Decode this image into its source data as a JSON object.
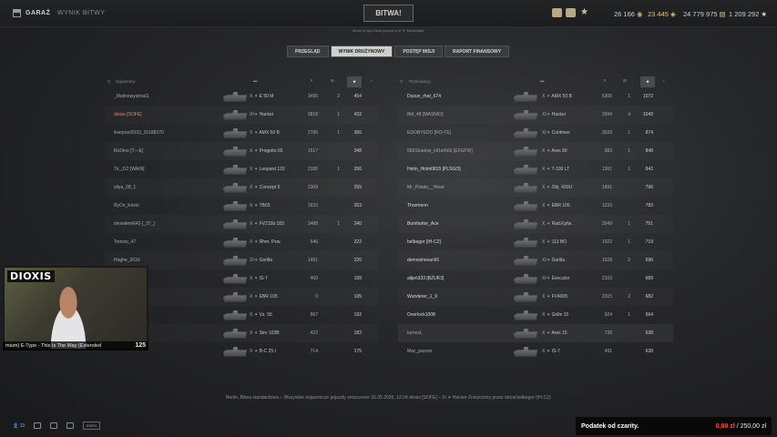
{
  "topbar": {
    "garage": "GARAŻ",
    "battle_results": "WYNIK BITWY",
    "battle_button": "BITWA!",
    "subline": "Może to być Ginie pozom a XI ✦ Wrushkiller",
    "credits": "26 166",
    "gold": "23 445",
    "free_xp": "24 779 975",
    "bonds": "1 209 292"
  },
  "tabs": [
    "PRZEGLĄD",
    "WYNIK DRUŻYNOWY",
    "POSTĘP MISJI",
    "RAPORT FINANSOWY"
  ],
  "active_tab": 1,
  "left_team": {
    "title": "Sojusznicy",
    "players": [
      {
        "name": "_Malinowystrzal1",
        "tier": "X",
        "tank": "E 50 M",
        "dmg": "3495",
        "kills": "2",
        "xp": "454"
      },
      {
        "name": "dioxis [SOFE]",
        "tier": "XI",
        "tank": "Hacker",
        "dmg": "3818",
        "kills": "1",
        "xp": "432",
        "own": true
      },
      {
        "name": "liverpool2033_15188370",
        "tier": "X",
        "tank": "AMX 50 B",
        "dmg": "2786",
        "kills": "1",
        "xp": "366"
      },
      {
        "name": "RoDino [T—E]",
        "tier": "X",
        "tank": "Progetto 65",
        "dmg": "1517",
        "kills": "",
        "xp": "348"
      },
      {
        "name": "Tir_J12 [WAIN]",
        "tier": "X",
        "tank": "Leopard 120",
        "dmg": "2186",
        "kills": "1",
        "xp": "266"
      },
      {
        "name": "vitya_98_1",
        "tier": "X",
        "tank": "Concept 5",
        "dmg": "2309",
        "kills": "",
        "xp": "255"
      },
      {
        "name": "RyOs_Kevin",
        "tier": "X",
        "tank": "TB03",
        "dmg": "1633",
        "kills": "",
        "xp": "253"
      },
      {
        "name": "showtime643 [_37_]",
        "tier": "X",
        "tank": "FV215b 183",
        "dmg": "1488",
        "kills": "1",
        "xp": "240"
      },
      {
        "name": "Tomcio_47",
        "tier": "X",
        "tank": "Rhm. Pzw.",
        "dmg": "646",
        "kills": "",
        "xp": "222"
      },
      {
        "name": "Hoghe_2016",
        "tier": "XI",
        "tank": "Gorilla",
        "dmg": "1491",
        "kills": "",
        "xp": "220"
      },
      {
        "name": "",
        "tier": "X",
        "tank": "IS-7",
        "dmg": "469",
        "kills": "",
        "xp": "199"
      },
      {
        "name": "",
        "tier": "X",
        "tank": "EBR 105",
        "dmg": "0",
        "kills": "",
        "xp": "195"
      },
      {
        "name": "",
        "tier": "X",
        "tank": "Vz. 55",
        "dmg": "867",
        "kills": "",
        "xp": "192"
      },
      {
        "name": "",
        "tier": "X",
        "tank": "Strv 103B",
        "dmg": "422",
        "kills": "",
        "xp": "182"
      },
      {
        "name": "",
        "tier": "X",
        "tank": "B-C 25 t",
        "dmg": "714",
        "kills": "",
        "xp": "175"
      }
    ]
  },
  "right_team": {
    "title": "Przeciwnicy",
    "players": [
      {
        "name": "Dusun_rhat_674",
        "tier": "X",
        "tank": "AMX 50 B",
        "dmg": "6306",
        "kills": "1",
        "xp": "1072",
        "alive": true
      },
      {
        "name": "Bitt_48 [MASNIO]",
        "tier": "XI",
        "tank": "Hacker",
        "dmg": "2594",
        "kills": "4",
        "xp": "1049"
      },
      {
        "name": "EDOBYEDO [RO-TE]",
        "tier": "XI",
        "tank": "Contriver",
        "dmg": "3529",
        "kills": "1",
        "xp": "874"
      },
      {
        "name": "666Shadow_kil1er666 [EFGFW]",
        "tier": "X",
        "tank": "Ares 90",
        "dmg": "983",
        "kills": "1",
        "xp": "848"
      },
      {
        "name": "Helm_Holm0815 [PLSGO]",
        "tier": "X",
        "tank": "T-100 LT",
        "dmg": "1361",
        "kills": "1",
        "xp": "842",
        "alive": true
      },
      {
        "name": "Mr_Potato__Head",
        "tier": "X",
        "tank": "Obj. 430U",
        "dmg": "1891",
        "kills": "",
        "xp": "796"
      },
      {
        "name": "Thormenn",
        "tier": "X",
        "tank": "EBR 105",
        "dmg": "1233",
        "kills": "",
        "xp": "783",
        "alive": true
      },
      {
        "name": "Bomfanter_Ace",
        "tier": "X",
        "tank": "Rad.Kpfw.",
        "dmg": "2649",
        "kills": "1",
        "xp": "751",
        "alive": true
      },
      {
        "name": "belbegor [IH-CZ]",
        "tier": "X",
        "tank": "113 BO",
        "dmg": "1022",
        "kills": "1",
        "xp": "719",
        "alive": true
      },
      {
        "name": "demnishevan91",
        "tier": "XI",
        "tank": "Gorilla",
        "dmg": "1528",
        "kills": "2",
        "xp": "696",
        "alive": true
      },
      {
        "name": "alijen333 [BZUK3]",
        "tier": "XI",
        "tank": "Executor",
        "dmg": "2103",
        "kills": "",
        "xp": "689",
        "alive": true
      },
      {
        "name": "Wunderer_1_9",
        "tier": "X",
        "tank": "FV4005",
        "dmg": "2315",
        "kills": "2",
        "xp": "682",
        "alive": true
      },
      {
        "name": "Overlock1008",
        "tier": "X",
        "tank": "Grille 15",
        "dmg": "924",
        "kills": "1",
        "xp": "664",
        "alive": true
      },
      {
        "name": "turnoxL",
        "tier": "X",
        "tank": "Ares 15",
        "dmg": "739",
        "kills": "",
        "xp": "638"
      },
      {
        "name": "Mac_panzer",
        "tier": "X",
        "tank": "IS-7",
        "dmg": "491",
        "kills": "",
        "xp": "638"
      }
    ]
  },
  "footer": "Berlin, Bitwa standardowa – Wszystkie sojusznicze pojazdy zniszczone     31.05.2026, 12:24     dioxis [SOFE] – XI ✦ Hacker     Zniszczony przez strzał belbegor (IH-CZ)",
  "overlay": {
    "streamer": "DIOXIS",
    "ticker": "mium) E-Type - This Is The Way (Extended",
    "ticker_num": "125",
    "tax_label": "Podatek od czarity.",
    "tax_paid": "0,00 zł",
    "tax_total": " / 250,00 zł"
  },
  "bottom": {
    "count": "13",
    "hidden_tag": "ENTG"
  }
}
